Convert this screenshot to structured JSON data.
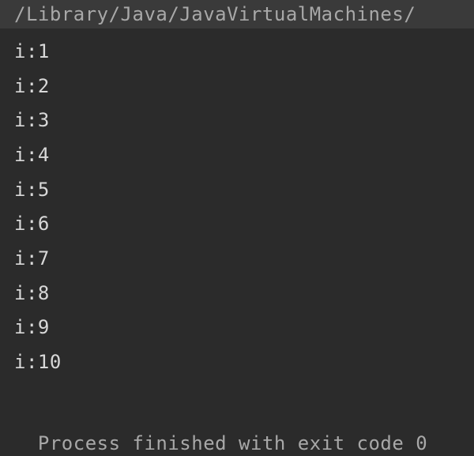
{
  "header": {
    "path": "/Library/Java/JavaVirtualMachines/"
  },
  "output": {
    "lines": [
      "i:1",
      "i:2",
      "i:3",
      "i:4",
      "i:5",
      "i:6",
      "i:7",
      "i:8",
      "i:9",
      "i:10"
    ]
  },
  "status": {
    "message": "Process finished with exit code 0"
  }
}
